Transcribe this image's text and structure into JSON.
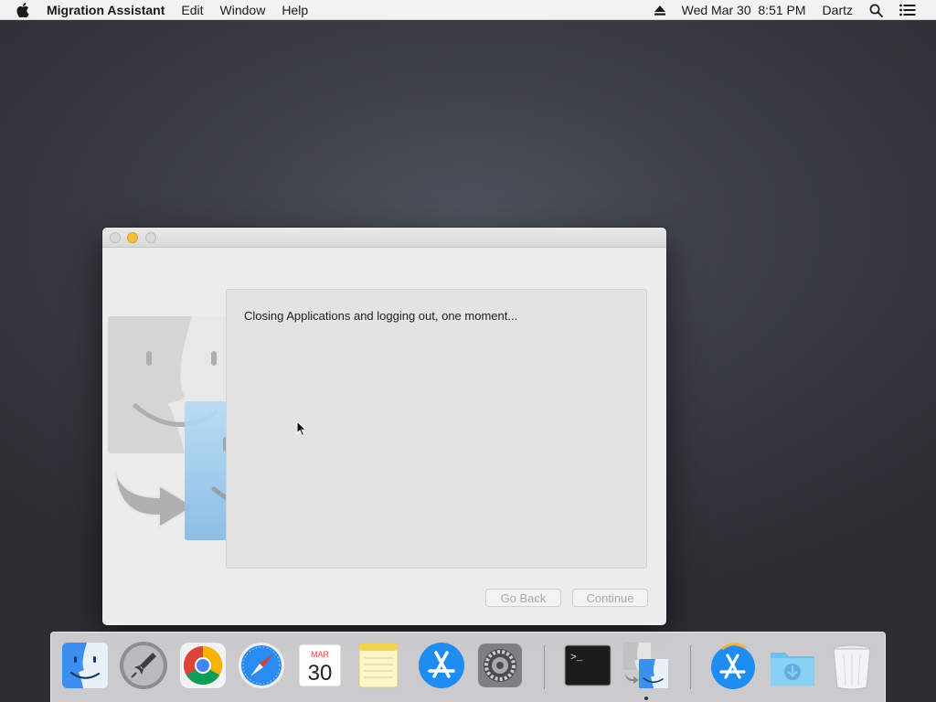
{
  "menubar": {
    "app_name": "Migration Assistant",
    "menus": [
      "Edit",
      "Window",
      "Help"
    ],
    "datetime": "Wed Mar 30  8:51 PM",
    "user": "Dartz",
    "icons": [
      "apple-icon",
      "eject-icon",
      "spotlight-search-icon",
      "notification-center-icon"
    ]
  },
  "window": {
    "status_text": "Closing Applications and logging out, one moment...",
    "buttons": {
      "go_back": "Go Back",
      "continue": "Continue"
    },
    "traffic_light_colors": {
      "minimize": "#f6be3a",
      "inactive": "#d9d9d9"
    }
  },
  "dock": {
    "items": [
      {
        "name": "Finder",
        "icon": "finder-icon"
      },
      {
        "name": "Launchpad",
        "icon": "launchpad-icon"
      },
      {
        "name": "Google Chrome",
        "icon": "chrome-icon"
      },
      {
        "name": "Safari",
        "icon": "safari-icon"
      },
      {
        "name": "Calendar",
        "icon": "calendar-icon",
        "month": "MAR",
        "day": "30"
      },
      {
        "name": "Notes",
        "icon": "notes-icon"
      },
      {
        "name": "App Store",
        "icon": "app-store-icon"
      },
      {
        "name": "System Preferences",
        "icon": "system-preferences-icon"
      },
      {
        "name": "Terminal",
        "icon": "terminal-icon",
        "prompt": ">_"
      },
      {
        "name": "Migration Assistant",
        "icon": "migration-assistant-icon",
        "running": true
      },
      {
        "name": "App Store Folder",
        "icon": "app-store-folder-icon"
      },
      {
        "name": "Downloads",
        "icon": "downloads-folder-icon"
      },
      {
        "name": "Trash",
        "icon": "trash-icon"
      }
    ]
  }
}
